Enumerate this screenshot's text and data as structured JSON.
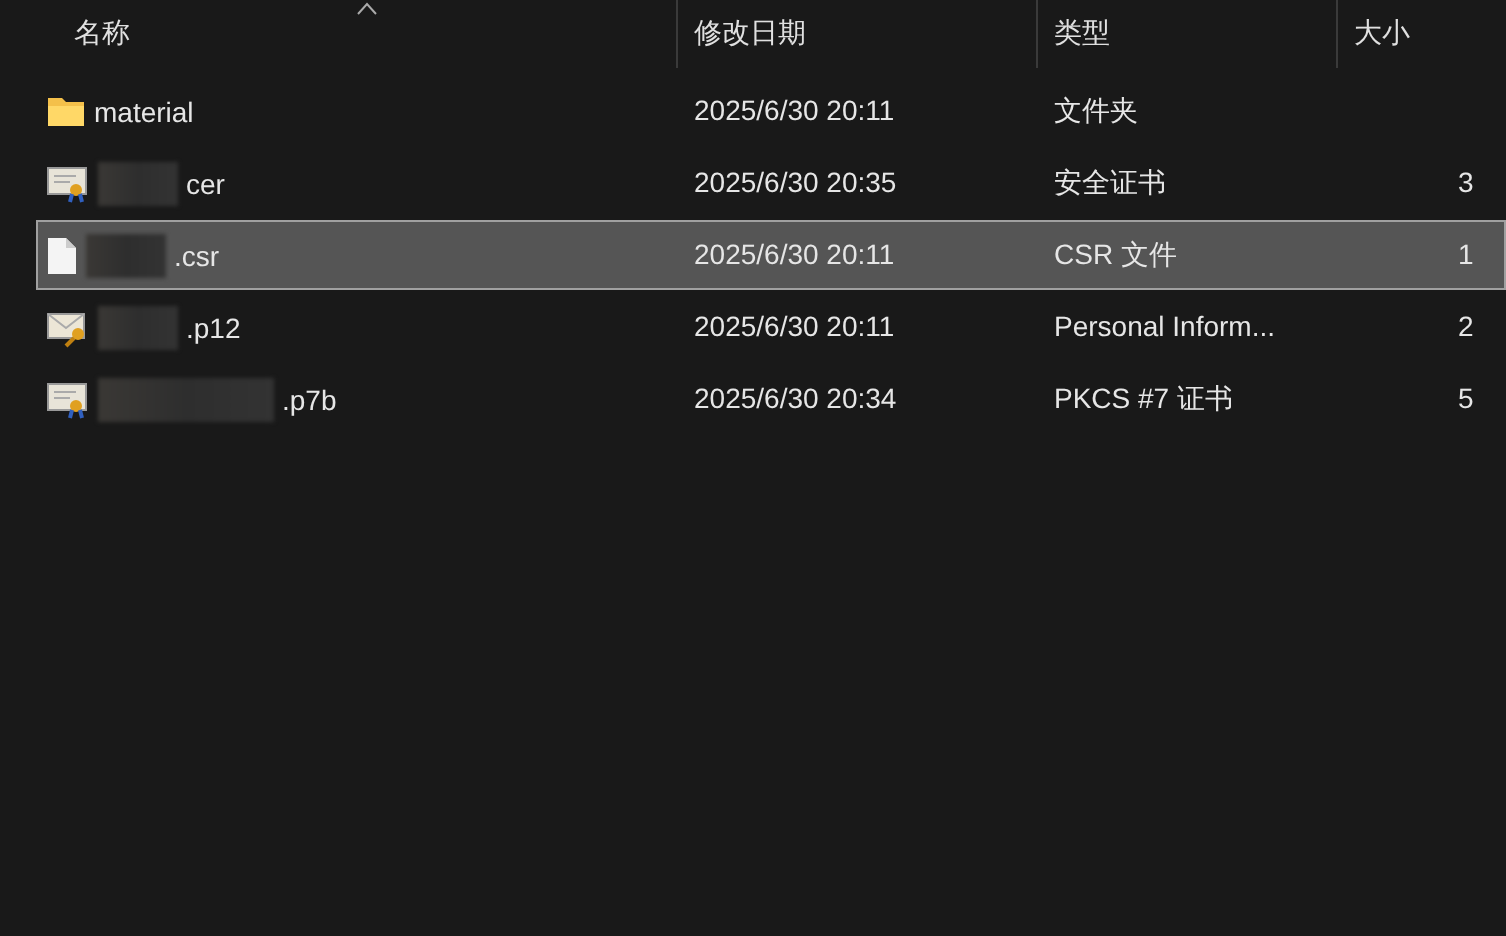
{
  "columns": [
    {
      "label": "名称",
      "sorted": true
    },
    {
      "label": "修改日期",
      "sorted": false
    },
    {
      "label": "类型",
      "sorted": false
    },
    {
      "label": "大小",
      "sorted": false
    }
  ],
  "rows": [
    {
      "kind": "folder",
      "name": "material",
      "redacted": false,
      "date": "2025/6/30 20:11",
      "type": "文件夹",
      "selected": false
    },
    {
      "kind": "cert",
      "name": "cer",
      "redacted": true,
      "date": "2025/6/30 20:35",
      "type": "安全证书",
      "size": "3",
      "selected": false
    },
    {
      "kind": "file",
      "name": ".csr",
      "redacted": true,
      "date": "2025/6/30 20:11",
      "type": "CSR 文件",
      "size": "1",
      "selected": true
    },
    {
      "kind": "key",
      "name": ".p12",
      "redacted": true,
      "date": "2025/6/30 20:11",
      "type": "Personal Inform...",
      "size": "2",
      "selected": false
    },
    {
      "kind": "cert",
      "name": ".p7b",
      "redacted": true,
      "wide": true,
      "date": "2025/6/30 20:34",
      "type": "PKCS #7 证书",
      "size": "5",
      "selected": false
    }
  ]
}
